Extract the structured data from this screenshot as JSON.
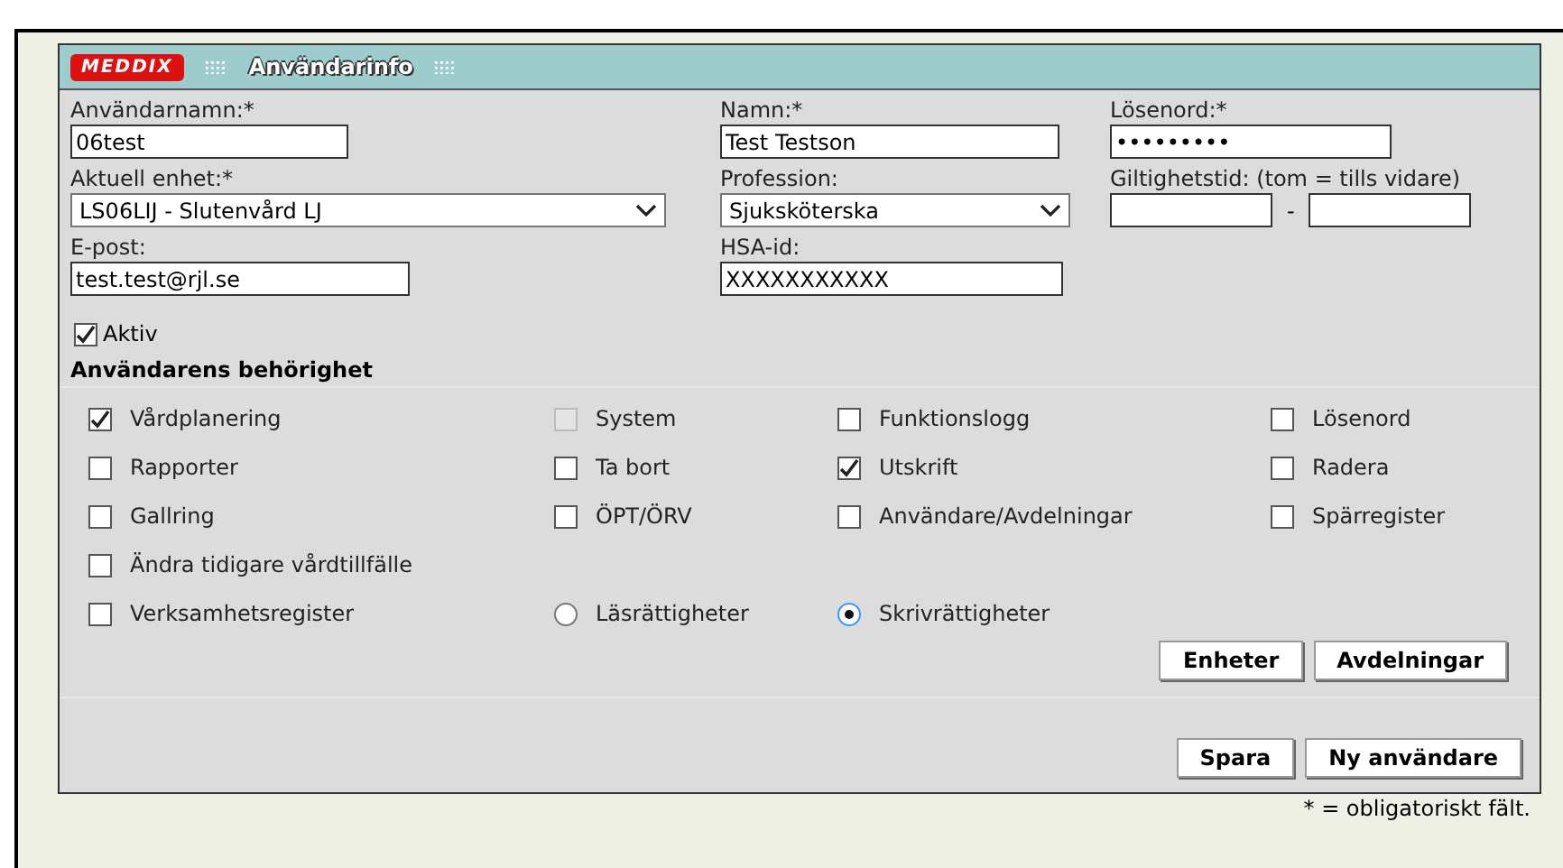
{
  "header": {
    "logo": "MEDDIX",
    "title": "Användarinfo"
  },
  "fields": [
    {
      "kind": "text",
      "label": "Användarnamn:*",
      "value": "06test"
    },
    {
      "kind": "text",
      "label": "Namn:*",
      "value": "Test Testson"
    },
    {
      "kind": "text",
      "label": "Lösenord:*",
      "value": "•••••••••"
    },
    {
      "kind": "select",
      "label": "Aktuell enhet:*",
      "value": "LS06LIJ - Slutenvård LJ"
    },
    {
      "kind": "select",
      "label": "Profession:",
      "value": "Sjuksköterska"
    },
    {
      "kind": "range",
      "label": "Giltighetstid: (tom = tills vidare)",
      "separator": "-"
    },
    {
      "kind": "text",
      "label": "E-post:",
      "value": "test.test@rjl.se"
    },
    {
      "kind": "text",
      "label": "HSA-id:",
      "value": "XXXXXXXXXXX"
    }
  ],
  "active": {
    "label": "Aktiv",
    "checked": true
  },
  "permissions_title": "Användarens behörighet",
  "permission_rows": [
    [
      {
        "kind": "checkbox",
        "label": "Vårdplanering",
        "checked": true,
        "disabled": false
      },
      {
        "kind": "checkbox",
        "label": "System",
        "checked": false,
        "disabled": true
      },
      {
        "kind": "checkbox",
        "label": "Funktionslogg",
        "checked": false,
        "disabled": false
      },
      {
        "kind": "checkbox",
        "label": "Lösenord",
        "checked": false,
        "disabled": false
      }
    ],
    [
      {
        "kind": "checkbox",
        "label": "Rapporter",
        "checked": false,
        "disabled": false
      },
      {
        "kind": "checkbox",
        "label": "Ta bort",
        "checked": false,
        "disabled": false
      },
      {
        "kind": "checkbox",
        "label": "Utskrift",
        "checked": true,
        "disabled": false
      },
      {
        "kind": "checkbox",
        "label": "Radera",
        "checked": false,
        "disabled": false
      }
    ],
    [
      {
        "kind": "checkbox",
        "label": "Gallring",
        "checked": false,
        "disabled": false
      },
      {
        "kind": "checkbox",
        "label": "ÖPT/ÖRV",
        "checked": false,
        "disabled": false
      },
      {
        "kind": "checkbox",
        "label": "Användare/Avdelningar",
        "checked": false,
        "disabled": false
      },
      {
        "kind": "checkbox",
        "label": "Spärregister",
        "checked": false,
        "disabled": false
      }
    ],
    [
      {
        "kind": "checkbox",
        "label": "Ändra tidigare vårdtillfälle",
        "checked": false,
        "disabled": false
      }
    ],
    [
      {
        "kind": "checkbox",
        "label": "Verksamhetsregister",
        "checked": false,
        "disabled": false
      },
      {
        "kind": "radio",
        "label": "Läsrättigheter",
        "selected": false
      },
      {
        "kind": "radio",
        "label": "Skrivrättigheter",
        "selected": true
      }
    ]
  ],
  "unit_buttons": [
    "Enheter",
    "Avdelningar"
  ],
  "action_buttons": [
    "Spara",
    "Ny användare"
  ],
  "footnote": "* = obligatoriskt fält."
}
